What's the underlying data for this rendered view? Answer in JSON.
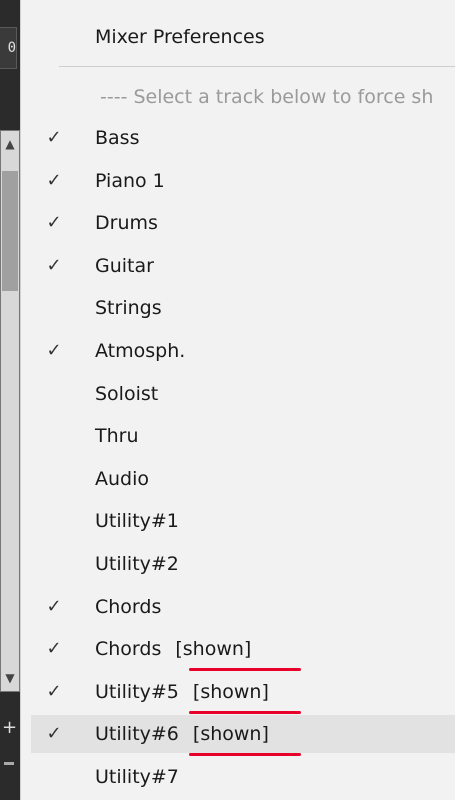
{
  "host": {
    "top_box_text": "0"
  },
  "menu": {
    "header_label": "Mixer Preferences",
    "hint_text": "---- Select a track below to force sh",
    "items": [
      {
        "label": "Bass",
        "checked": true,
        "suffix": ""
      },
      {
        "label": "Piano 1",
        "checked": true,
        "suffix": ""
      },
      {
        "label": "Drums",
        "checked": true,
        "suffix": ""
      },
      {
        "label": "Guitar",
        "checked": true,
        "suffix": ""
      },
      {
        "label": "Strings",
        "checked": false,
        "suffix": ""
      },
      {
        "label": "Atmosph.",
        "checked": true,
        "suffix": ""
      },
      {
        "label": "Soloist",
        "checked": false,
        "suffix": ""
      },
      {
        "label": "Thru",
        "checked": false,
        "suffix": ""
      },
      {
        "label": "Audio",
        "checked": false,
        "suffix": ""
      },
      {
        "label": "Utility#1",
        "checked": false,
        "suffix": ""
      },
      {
        "label": "Utility#2",
        "checked": false,
        "suffix": ""
      },
      {
        "label": "Chords",
        "checked": true,
        "suffix": ""
      },
      {
        "label": "Chords",
        "checked": true,
        "suffix": "[shown]"
      },
      {
        "label": "Utility#5",
        "checked": true,
        "suffix": "[shown]"
      },
      {
        "label": "Utility#6",
        "checked": true,
        "suffix": "[shown]",
        "highlighted": true
      },
      {
        "label": "Utility#7",
        "checked": false,
        "suffix": ""
      }
    ],
    "check_glyph": "✓",
    "annotation_color": "#e8002a"
  }
}
